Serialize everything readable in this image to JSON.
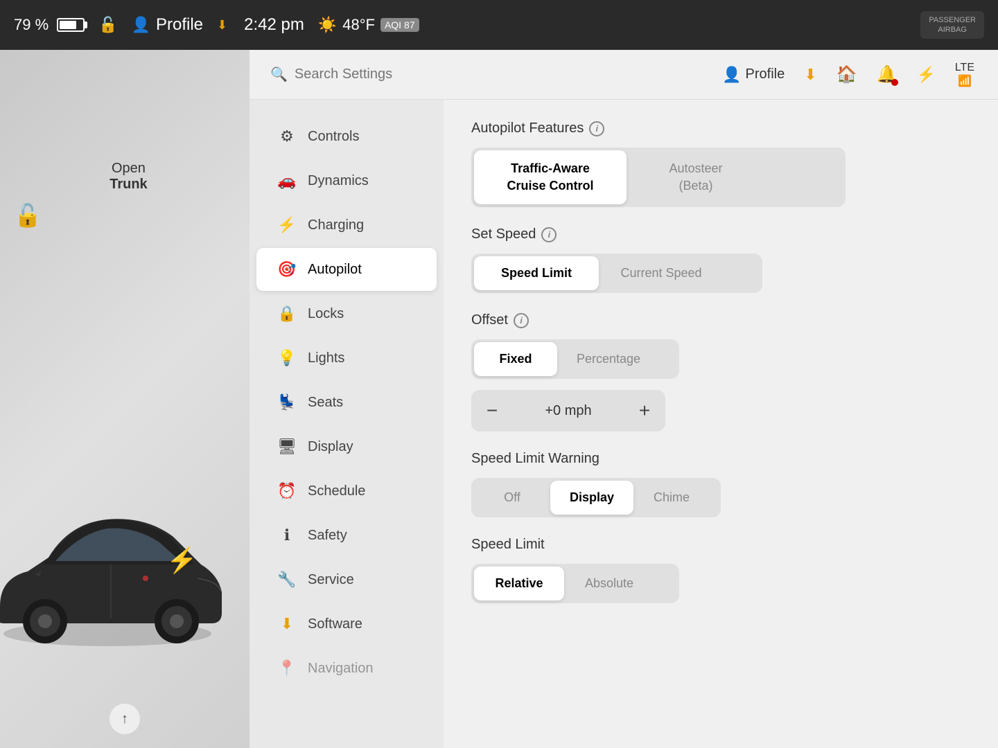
{
  "statusBar": {
    "battery": "79 %",
    "time": "2:42 pm",
    "temperature": "48°F",
    "aqi": "AQI 87",
    "profile": "Profile",
    "passengerAirbag": "PASSENGER\nAIRBAG"
  },
  "search": {
    "placeholder": "Search Settings"
  },
  "topIcons": {
    "profile": "Profile",
    "download": "⬇",
    "home": "🏠",
    "notification": "🔔",
    "bluetooth": "⚡",
    "signal": "LTE"
  },
  "sidebar": {
    "items": [
      {
        "id": "controls",
        "label": "Controls",
        "icon": "⚙"
      },
      {
        "id": "dynamics",
        "label": "Dynamics",
        "icon": "🚗"
      },
      {
        "id": "charging",
        "label": "Charging",
        "icon": "⚡"
      },
      {
        "id": "autopilot",
        "label": "Autopilot",
        "icon": "🎯"
      },
      {
        "id": "locks",
        "label": "Locks",
        "icon": "🔒"
      },
      {
        "id": "lights",
        "label": "Lights",
        "icon": "💡"
      },
      {
        "id": "seats",
        "label": "Seats",
        "icon": "💺"
      },
      {
        "id": "display",
        "label": "Display",
        "icon": "🖥"
      },
      {
        "id": "schedule",
        "label": "Schedule",
        "icon": "⏰"
      },
      {
        "id": "safety",
        "label": "Safety",
        "icon": "ℹ"
      },
      {
        "id": "service",
        "label": "Service",
        "icon": "🔧"
      },
      {
        "id": "software",
        "label": "Software",
        "icon": "⬇"
      },
      {
        "id": "navigation",
        "label": "Navigation",
        "icon": "📍"
      }
    ]
  },
  "autopilot": {
    "featuresTitle": "Autopilot Features",
    "options": {
      "trafficAware": "Traffic-Aware\nCruise Control",
      "autosteer": "Autosteer\n(Beta)"
    },
    "setSpeed": {
      "title": "Set Speed",
      "speedLimit": "Speed Limit",
      "currentSpeed": "Current Speed"
    },
    "offset": {
      "title": "Offset",
      "fixed": "Fixed",
      "percentage": "Percentage",
      "value": "+0 mph"
    },
    "speedLimitWarning": {
      "title": "Speed Limit Warning",
      "off": "Off",
      "display": "Display",
      "chime": "Chime"
    },
    "speedLimit": {
      "title": "Speed Limit",
      "relative": "Relative",
      "absolute": "Absolute"
    }
  },
  "car": {
    "openTrunk": "Open",
    "trunk": "Trunk"
  }
}
